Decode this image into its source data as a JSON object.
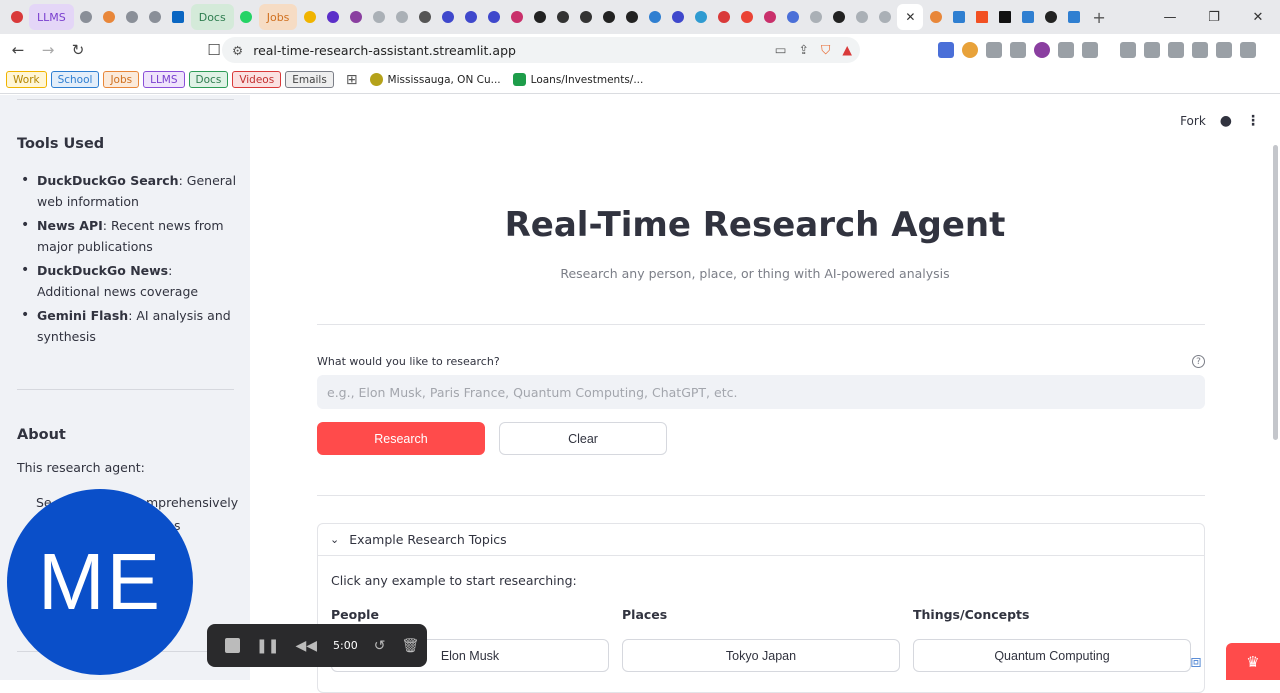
{
  "browser": {
    "tabs_labeled": [
      "LLMS",
      "Docs",
      "Jobs"
    ],
    "url": "real-time-research-assistant.streamlit.app",
    "bookmarks_chips": [
      {
        "label": "Work",
        "color": "#f0b400"
      },
      {
        "label": "School",
        "color": "#2f7fd1"
      },
      {
        "label": "Jobs",
        "color": "#e8873a"
      },
      {
        "label": "LLMS",
        "color": "#8a4fd8"
      },
      {
        "label": "Docs",
        "color": "#2e9b57"
      },
      {
        "label": "Videos",
        "color": "#d93a3a"
      },
      {
        "label": "Emails",
        "color": "#7b7e87"
      }
    ],
    "bookmark_links": [
      "Mississauga, ON Cu...",
      "Loans/Investments/..."
    ]
  },
  "sidebar": {
    "tools_heading": "Tools Used",
    "tools": [
      {
        "name": "DuckDuckGo Search",
        "desc": ": General web information"
      },
      {
        "name": "News API",
        "desc": ": Recent news from major publications"
      },
      {
        "name": "DuckDuckGo News",
        "desc": ": Additional news coverage"
      },
      {
        "name": "Gemini Flash",
        "desc": ": AI analysis and synthesis"
      }
    ],
    "about_heading": "About",
    "about_intro": "This research agent:",
    "about_item1_partial": "Se",
    "about_item1_tail": "mprehensively",
    "about_item2_tail": "s"
  },
  "header": {
    "fork_label": "Fork"
  },
  "main": {
    "title": "Real-Time Research Agent",
    "subtitle": "Research any person, place, or thing with AI-powered analysis",
    "input_label": "What would you like to research?",
    "input_placeholder": "e.g., Elon Musk, Paris France, Quantum Computing, ChatGPT, etc.",
    "research_button": "Research",
    "clear_button": "Clear",
    "expander_title": "Example Research Topics",
    "expander_intro": "Click any example to start researching:",
    "categories": [
      {
        "heading": "People",
        "example": "Elon Musk"
      },
      {
        "heading": "Places",
        "example": "Tokyo Japan"
      },
      {
        "heading": "Things/Concepts",
        "example": "Quantum Computing"
      }
    ]
  },
  "overlay": {
    "avatar_initials": "ME",
    "recorder_time": "5:00"
  },
  "colors": {
    "primary": "#ff4b4b",
    "sidebar_bg": "#f0f2f6",
    "avatar_bg": "#0a4fc9"
  }
}
